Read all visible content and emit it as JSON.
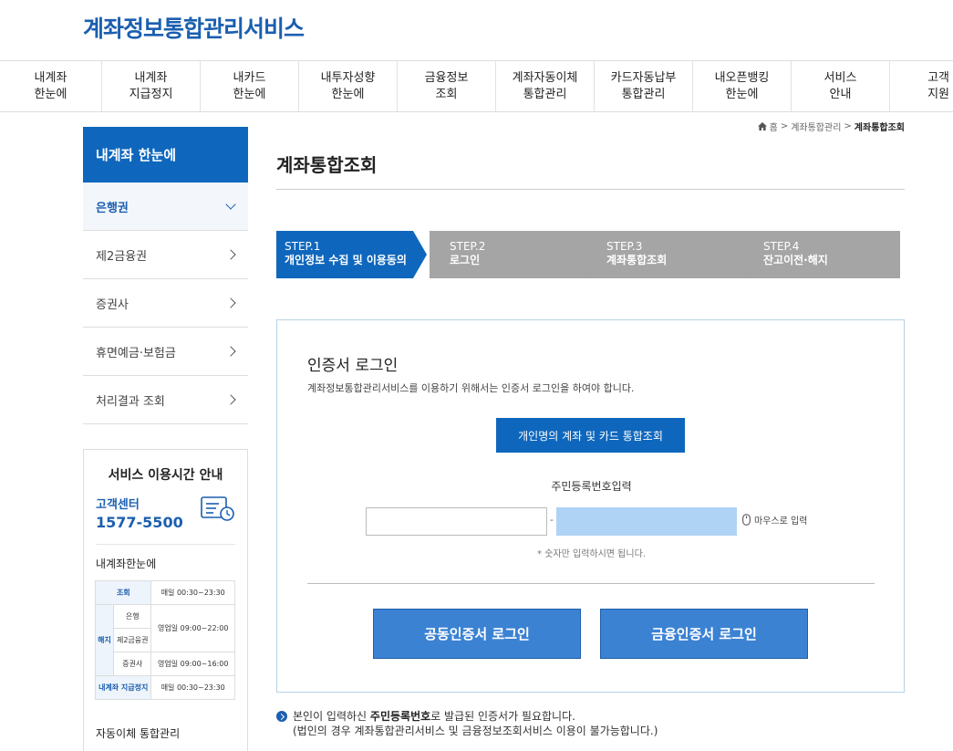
{
  "logo": "계좌정보통합관리서비스",
  "gnb": [
    "내계좌\n한눈에",
    "내계좌\n지급정지",
    "내카드\n한눈에",
    "내투자성향\n한눈에",
    "금융정보\n조회",
    "계좌자동이체\n통합관리",
    "카드자동납부\n통합관리",
    "내오픈뱅킹\n한눈에",
    "서비스\n안내",
    "고객\n지원"
  ],
  "breadcrumb": {
    "home": "홈",
    "mid": "계좌통합관리",
    "current": "계좌통합조회",
    "sep": ">"
  },
  "lnb": {
    "title": "내계좌 한눈에",
    "items": [
      "은행권",
      "제2금융권",
      "증권사",
      "휴면예금·보험금",
      "처리결과 조회"
    ]
  },
  "service": {
    "title": "서비스 이용시간 안내",
    "cc_label": "고객센터",
    "cc_number": "1577-5500",
    "sub_title": "내계좌한눈에",
    "table": {
      "r1_label": "조회",
      "r1_time": "매일 00:30~23:30",
      "cancel_label": "해지",
      "r2_label": "은행",
      "r3_label": "제2금융권",
      "r23_time": "영업일 09:00~22:00",
      "r4_label": "증권사",
      "r4_time": "영업일 09:00~16:00",
      "r5_label": "내계좌 지급정지",
      "r5_time": "매일 00:30~23:30"
    },
    "more": "자동이체 통합관리"
  },
  "content_title": "계좌통합조회",
  "steps": [
    {
      "num": "STEP.1",
      "label": "개인정보 수집 및 이용동의"
    },
    {
      "num": "STEP.2",
      "label": "로그인"
    },
    {
      "num": "STEP.3",
      "label": "계좌통합조회"
    },
    {
      "num": "STEP.4",
      "label": "잔고이전·해지"
    }
  ],
  "login": {
    "title": "인증서 로그인",
    "desc": "계좌정보통합관리서비스를 이용하기 위해서는 인증서 로그인을 하여야 합니다.",
    "integ_button": "개인명의 계좌 및 카드 통합조회",
    "jumin_label": "주민등록번호입력",
    "dash": "-",
    "mouse_input": "마우스로 입력",
    "hint": "* 숫자만 입력하시면 됩니다.",
    "joint_cert": "공동인증서 로그인",
    "fin_cert": "금융인증서 로그인"
  },
  "notice": {
    "line1_pre": "본인이 입력하신 ",
    "line1_bold": "주민등록번호",
    "line1_post": "로 발급된 인증서가 필요합니다.",
    "line2": "(법인의 경우 계좌통합관리서비스 및 금융정보조회서비스 이용이 불가능합니다.)"
  }
}
